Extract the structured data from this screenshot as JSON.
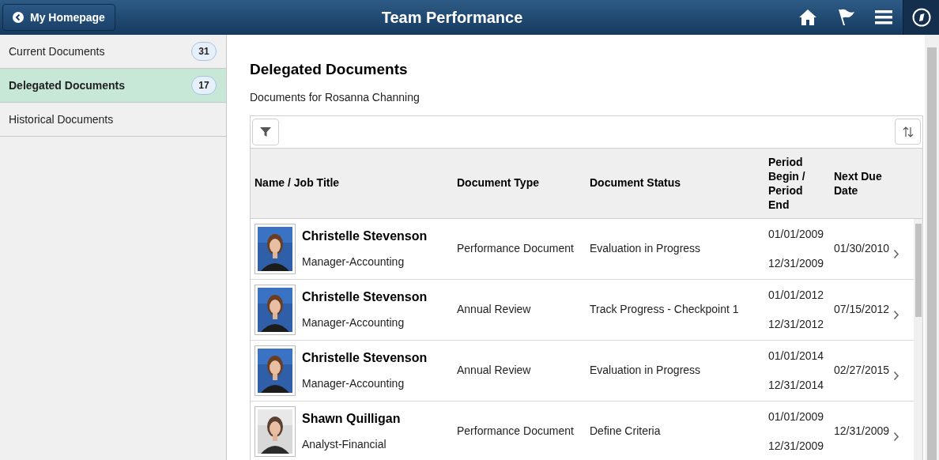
{
  "header": {
    "back_button": "My Homepage",
    "title": "Team Performance"
  },
  "sidebar": {
    "items": [
      {
        "label": "Current Documents",
        "count": "31",
        "selected": false
      },
      {
        "label": "Delegated Documents",
        "count": "17",
        "selected": true
      },
      {
        "label": "Historical Documents",
        "selected": false
      }
    ]
  },
  "main": {
    "title": "Delegated Documents",
    "subtitle": "Documents for Rosanna Channing",
    "table": {
      "columns": [
        "Name / Job Title",
        "Document Type",
        "Document Status",
        "Period Begin / Period End",
        "Next Due Date"
      ],
      "rows": [
        {
          "name": "Christelle Stevenson",
          "job_title": "Manager-Accounting",
          "document_type": "Performance Document",
          "document_status": "Evaluation in Progress",
          "period_begin": "01/01/2009",
          "period_end": "12/31/2009",
          "next_due_date": "01/30/2010"
        },
        {
          "name": "Christelle Stevenson",
          "job_title": "Manager-Accounting",
          "document_type": "Annual Review",
          "document_status": "Track Progress - Checkpoint 1",
          "period_begin": "01/01/2012",
          "period_end": "12/31/2012",
          "next_due_date": "07/15/2012"
        },
        {
          "name": "Christelle Stevenson",
          "job_title": "Manager-Accounting",
          "document_type": "Annual Review",
          "document_status": "Evaluation in Progress",
          "period_begin": "01/01/2014",
          "period_end": "12/31/2014",
          "next_due_date": "02/27/2015"
        },
        {
          "name": "Shawn Quilligan",
          "job_title": "Analyst-Financial",
          "document_type": "Performance Document",
          "document_status": "Define Criteria",
          "period_begin": "01/01/2009",
          "period_end": "12/31/2009",
          "next_due_date": "12/31/2009"
        }
      ]
    }
  }
}
